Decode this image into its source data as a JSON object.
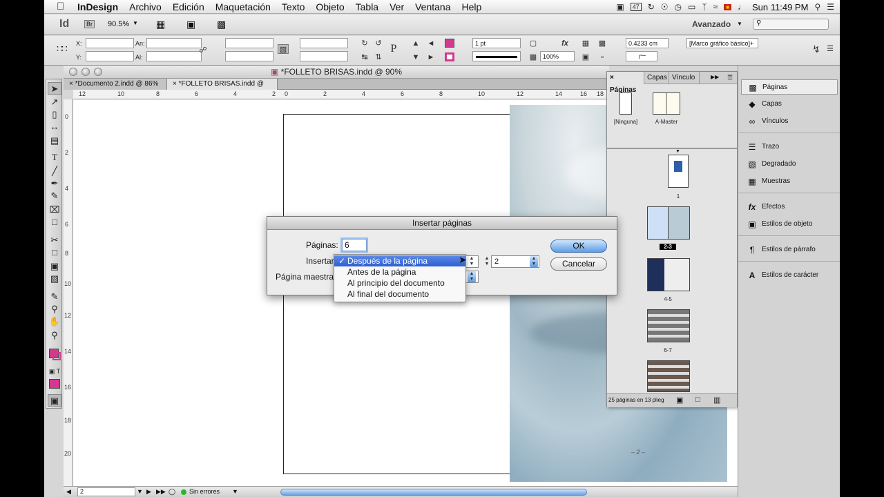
{
  "menubar": {
    "app_name": "InDesign",
    "items": [
      "Archivo",
      "Edición",
      "Maquetación",
      "Texto",
      "Objeto",
      "Tabla",
      "Ver",
      "Ventana",
      "Help"
    ],
    "battery": "47",
    "clock": "Sun 11:49 PM"
  },
  "appbar": {
    "logo": "Id",
    "bridge": "Br",
    "zoom": "90.5%",
    "workspace": "Avanzado"
  },
  "control": {
    "x_label": "X:",
    "y_label": "Y:",
    "w_label": "An:",
    "h_label": "Al:",
    "stroke_weight": "1 pt",
    "opacity": "100%",
    "offset": "0.4233 cm",
    "object_style": "[Marco gráfico básico]+"
  },
  "document": {
    "window_title": "*FOLLETO BRISAS.indd @ 90%",
    "tabs": [
      "*Documento 2.indd @ 86%",
      "*FOLLETO BRISAS.indd @ 90%"
    ],
    "ruler_top": [
      "12",
      "10",
      "8",
      "6",
      "4",
      "2",
      "0",
      "2",
      "4",
      "6",
      "8",
      "10",
      "12",
      "14",
      "16",
      "18"
    ],
    "ruler_left": [
      "0",
      "2",
      "4",
      "6",
      "8",
      "10",
      "12",
      "14",
      "16",
      "18",
      "20"
    ],
    "page_number_label": "– 2 –",
    "status_page": "2",
    "status_errors": "Sin errores"
  },
  "pages_panel": {
    "tabs": [
      "Páginas",
      "Capas",
      "Vínculo"
    ],
    "masters": [
      "[Ninguna]",
      "A-Master"
    ],
    "page_labels": [
      "1",
      "2-3",
      "4-5",
      "6-7"
    ],
    "footer": "25 páginas en 13 plieg"
  },
  "dock": {
    "items": [
      "Páginas",
      "Capas",
      "Vínculos",
      "Trazo",
      "Degradado",
      "Muestras",
      "Efectos",
      "Estilos de objeto",
      "Estilos de párrafo",
      "Estilos de carácter"
    ]
  },
  "dialog": {
    "title": "Insertar páginas",
    "pages_label": "Páginas:",
    "pages_value": "6",
    "insert_label": "Insertar:",
    "insert_page_value": "2",
    "master_label": "Página maestra:",
    "ok": "OK",
    "cancel": "Cancelar",
    "options": [
      "Después de la página",
      "Antes de la página",
      "Al principio del documento",
      "Al final del documento"
    ]
  }
}
